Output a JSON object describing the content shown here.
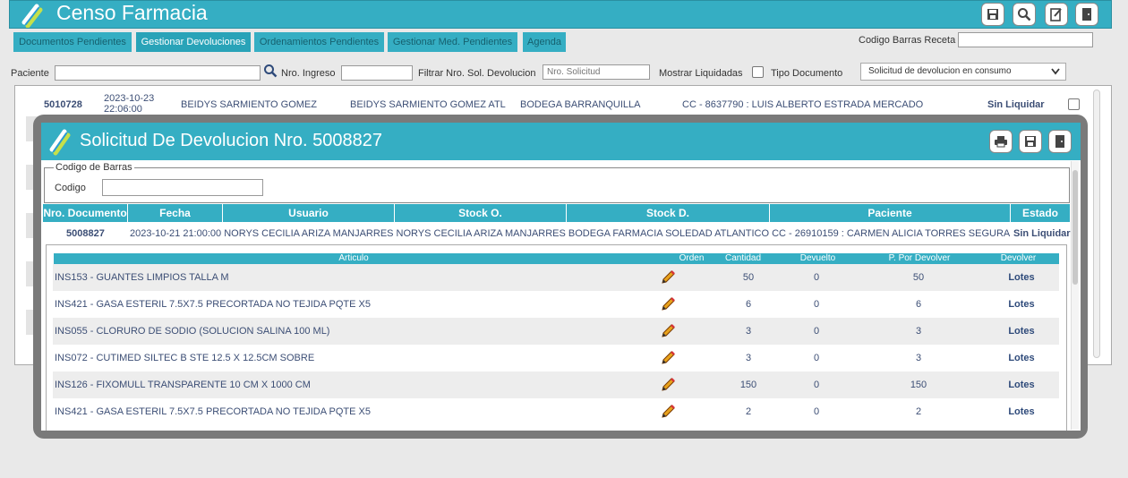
{
  "app": {
    "title": "Censo Farmacia"
  },
  "tabs": [
    {
      "label": "Documentos Pendientes",
      "active": false
    },
    {
      "label": "Gestionar Devoluciones",
      "active": true
    },
    {
      "label": "Ordenamientos Pendientes",
      "active": false
    },
    {
      "label": "Gestionar Med. Pendientes",
      "active": false
    },
    {
      "label": "Agenda",
      "active": false
    }
  ],
  "filters": {
    "barcode_label": "Codigo Barras Receta",
    "barcode_value": "",
    "patient_label": "Paciente",
    "patient_value": "",
    "ingreso_label": "Nro. Ingreso",
    "ingreso_value": "",
    "filter_label": "Filtrar Nro. Sol. Devolucion",
    "filter_placeholder": "Nro. Solicitud",
    "show_liquidated_label": "Mostrar Liquidadas",
    "doc_type_label": "Tipo Documento",
    "doc_type_selected": "Solicitud de devolucion en consumo"
  },
  "background_row": {
    "nro": "5010728",
    "date": "2023-10-23",
    "time": "22:06:00",
    "usuario": "BEIDYS SARMIENTO GOMEZ",
    "stock_o": "BEIDYS SARMIENTO GOMEZ ATL",
    "stock_d": "BODEGA BARRANQUILLA",
    "paciente": "CC - 8637790 : LUIS ALBERTO ESTRADA MERCADO",
    "estado": "Sin Liquidar"
  },
  "modal": {
    "title": "Solicitud De Devolucion Nro. 5008827",
    "barcode_legend": "Codigo de Barras",
    "codigo_label": "Codigo",
    "codigo_value": "",
    "doc_headers": [
      "Nro. Documento",
      "Fecha",
      "Usuario",
      "Stock O.",
      "Stock D.",
      "Paciente",
      "Estado"
    ],
    "doc": {
      "nro": "5008827",
      "detail": "2023-10-21 21:00:00 NORYS CECILIA ARIZA MANJARRES NORYS CECILIA ARIZA MANJARRES BODEGA FARMACIA SOLEDAD ATLANTICO CC - 26910159 : CARMEN ALICIA TORRES SEGURA",
      "estado": "Sin Liquidar"
    },
    "item_headers": {
      "articulo": "Articulo",
      "orden": "Orden",
      "cantidad": "Cantidad",
      "devuelto": "Devuelto",
      "por_devolver": "P. Por Devolver",
      "devolver": "Devolver"
    },
    "items": [
      {
        "articulo": "INS153 - GUANTES LIMPIOS TALLA M",
        "cantidad": "50",
        "devuelto": "0",
        "por_devolver": "50",
        "devolver": "Lotes"
      },
      {
        "articulo": "INS421 - GASA ESTERIL 7.5X7.5 PRECORTADA NO TEJIDA PQTE X5",
        "cantidad": "6",
        "devuelto": "0",
        "por_devolver": "6",
        "devolver": "Lotes"
      },
      {
        "articulo": "INS055 - CLORURO DE SODIO (SOLUCION SALINA 100 ML)",
        "cantidad": "3",
        "devuelto": "0",
        "por_devolver": "3",
        "devolver": "Lotes"
      },
      {
        "articulo": "INS072 - CUTIMED SILTEC B STE 12.5 X 12.5CM SOBRE",
        "cantidad": "3",
        "devuelto": "0",
        "por_devolver": "3",
        "devolver": "Lotes"
      },
      {
        "articulo": "INS126 - FIXOMULL TRANSPARENTE 10 CM X 1000 CM",
        "cantidad": "150",
        "devuelto": "0",
        "por_devolver": "150",
        "devolver": "Lotes"
      },
      {
        "articulo": "INS421 - GASA ESTERIL 7.5X7.5 PRECORTADA NO TEJIDA PQTE X5",
        "cantidad": "2",
        "devuelto": "0",
        "por_devolver": "2",
        "devolver": "Lotes"
      }
    ]
  },
  "colors": {
    "accent": "#35aec3",
    "text": "#3c4e75",
    "overlay": "#7a7a7a"
  }
}
